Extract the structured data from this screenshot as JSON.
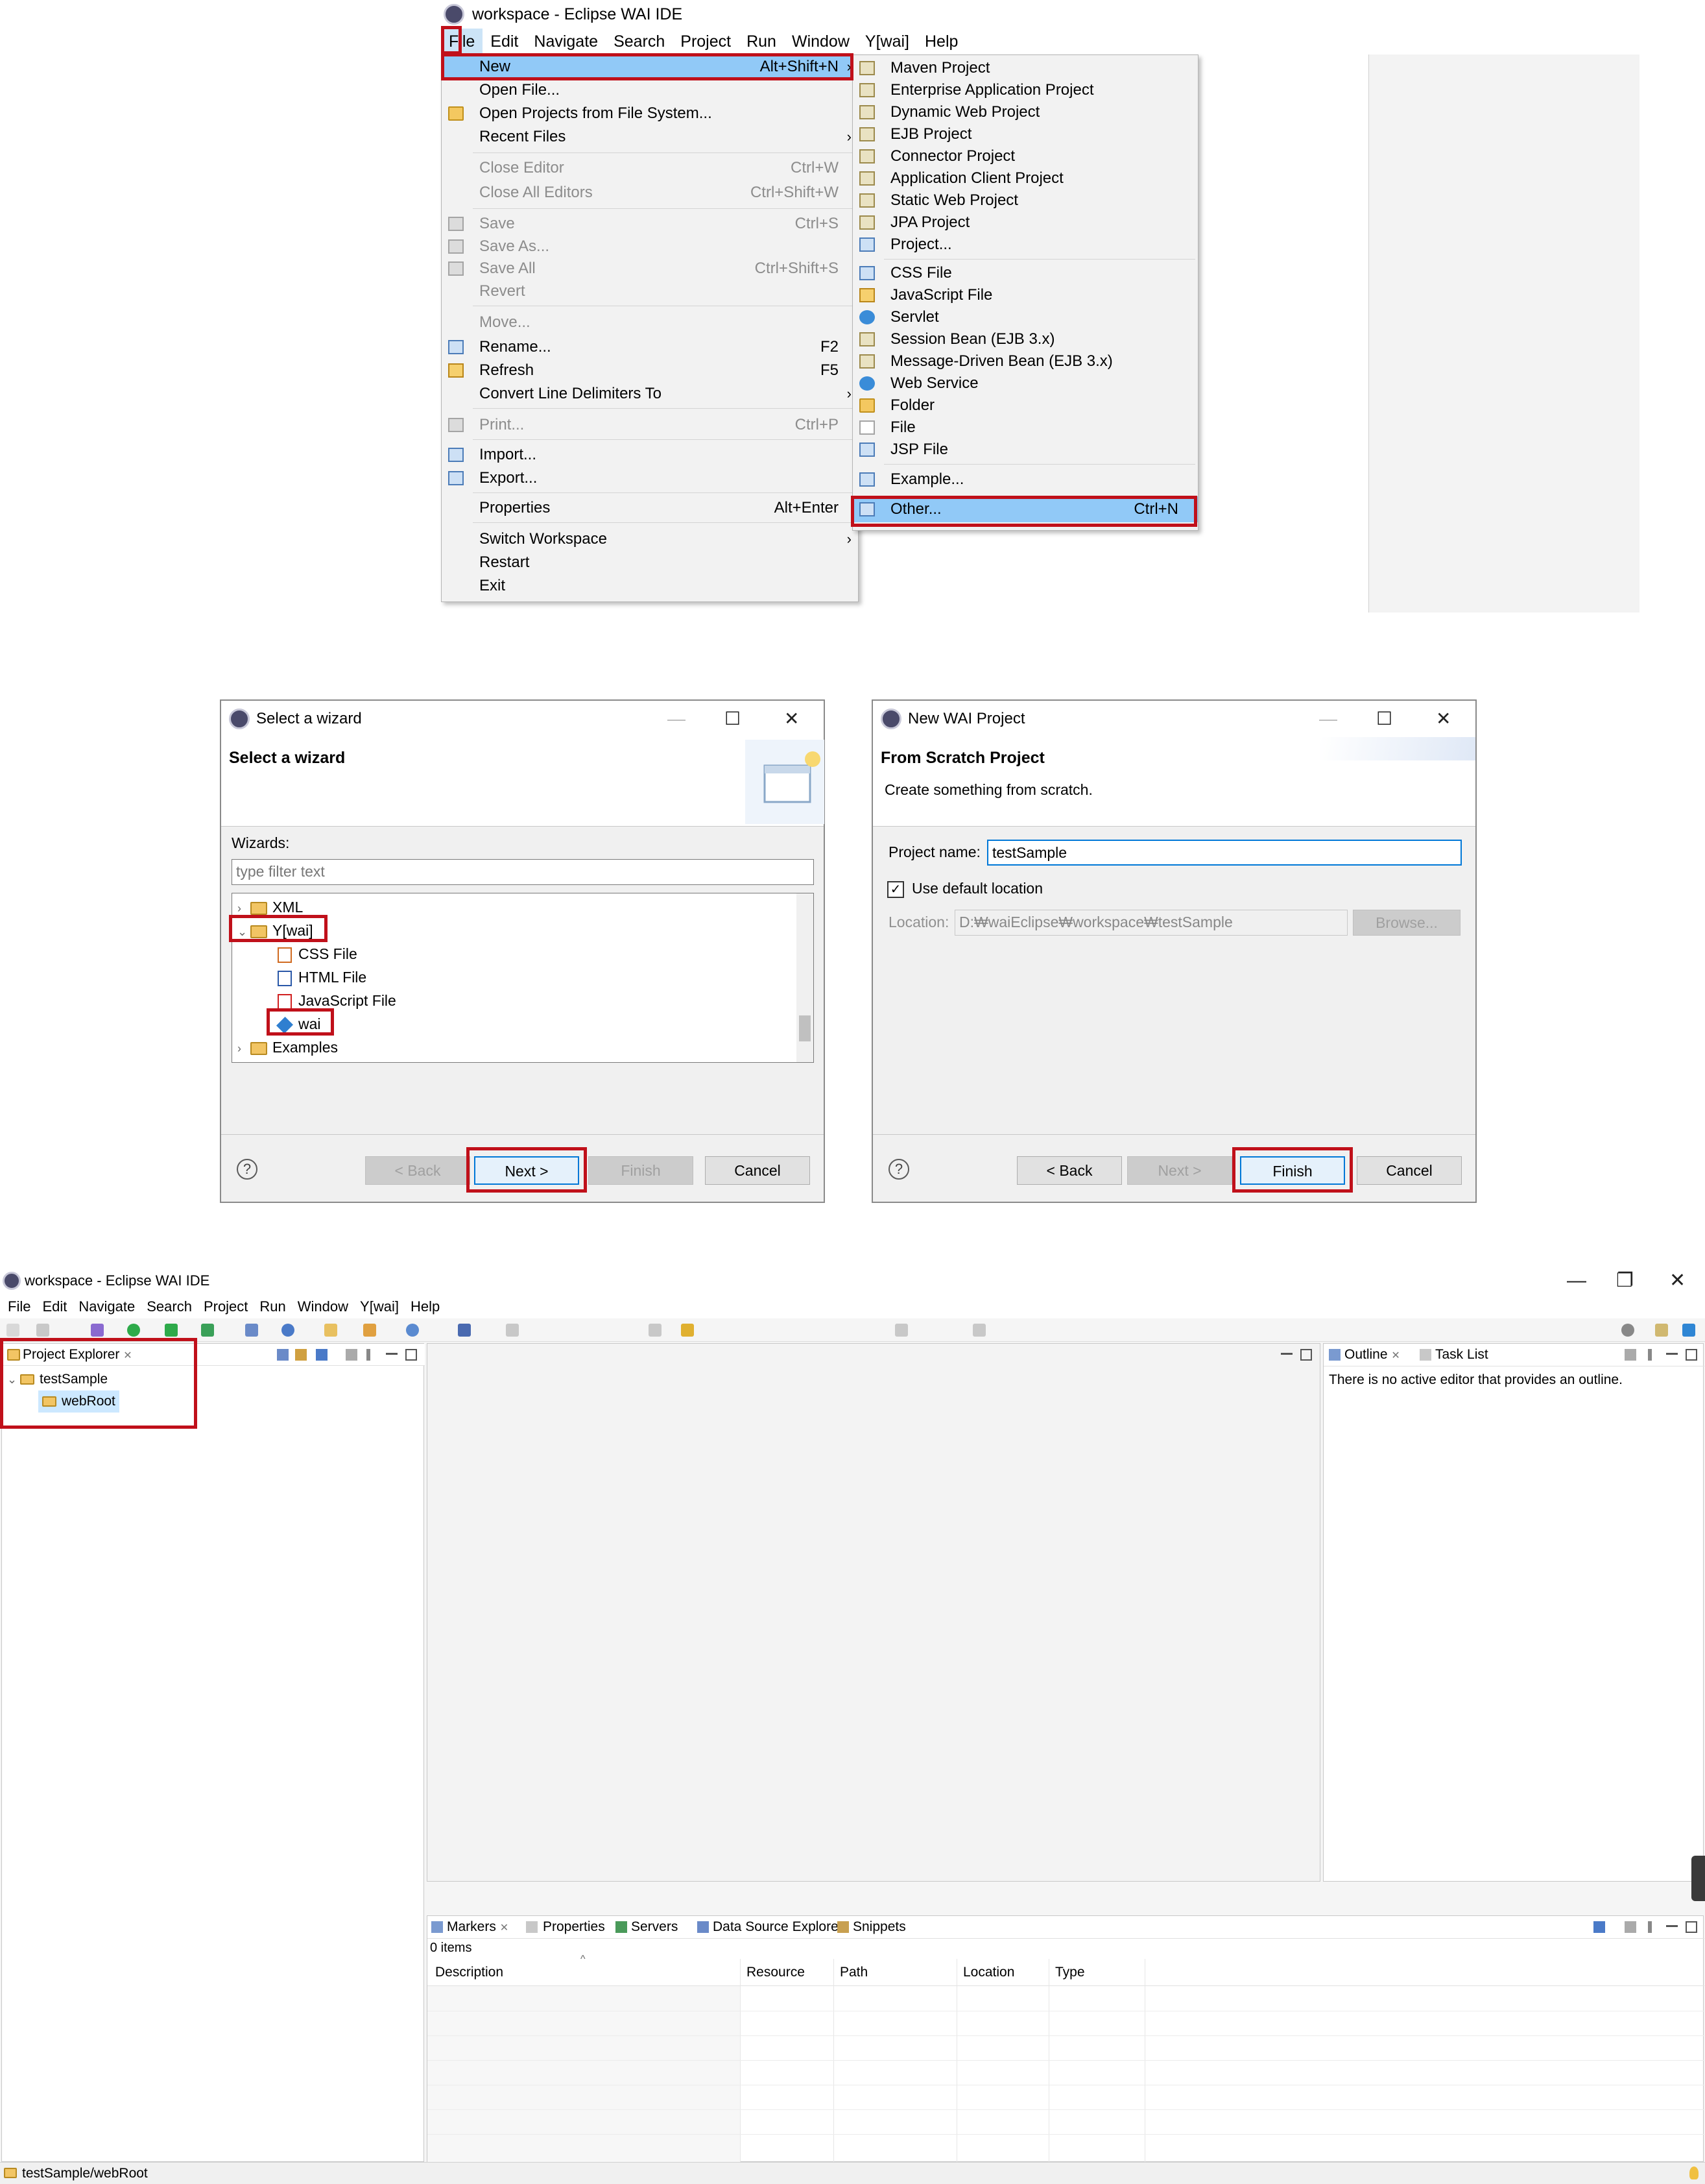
{
  "section1": {
    "window_title": "workspace - Eclipse WAI IDE",
    "menubar": [
      "File",
      "Edit",
      "Navigate",
      "Search",
      "Project",
      "Run",
      "Window",
      "Y[wai]",
      "Help"
    ],
    "file_menu": {
      "new": {
        "label": "New",
        "shortcut": "Alt+Shift+N",
        "arrow": "›"
      },
      "open_file": "Open File...",
      "open_projects": "Open Projects from File System...",
      "recent_files": "Recent Files",
      "close_editor": "Close Editor",
      "close_editor_sc": "Ctrl+W",
      "close_all": "Close All Editors",
      "close_all_sc": "Ctrl+Shift+W",
      "save": "Save",
      "save_sc": "Ctrl+S",
      "save_as": "Save As...",
      "save_all": "Save All",
      "save_all_sc": "Ctrl+Shift+S",
      "revert": "Revert",
      "move": "Move...",
      "rename": "Rename...",
      "rename_sc": "F2",
      "refresh": "Refresh",
      "refresh_sc": "F5",
      "convert": "Convert Line Delimiters To",
      "print": "Print...",
      "print_sc": "Ctrl+P",
      "import": "Import...",
      "export": "Export...",
      "properties": "Properties",
      "properties_sc": "Alt+Enter",
      "switch_ws": "Switch Workspace",
      "restart": "Restart",
      "exit": "Exit",
      "arrow": "›"
    },
    "new_submenu": {
      "maven": "Maven Project",
      "enterprise": "Enterprise Application Project",
      "dynamic_web": "Dynamic Web Project",
      "ejb": "EJB Project",
      "connector": "Connector Project",
      "app_client": "Application Client Project",
      "static_web": "Static Web Project",
      "jpa": "JPA Project",
      "project": "Project...",
      "css": "CSS File",
      "js": "JavaScript File",
      "servlet": "Servlet",
      "session_bean": "Session Bean (EJB 3.x)",
      "mdb": "Message-Driven Bean (EJB 3.x)",
      "web_service": "Web Service",
      "folder": "Folder",
      "file": "File",
      "jsp": "JSP File",
      "example": "Example...",
      "other": "Other...",
      "other_sc": "Ctrl+N"
    }
  },
  "wizard": {
    "title": "Select a wizard",
    "header_title": "Select a wizard",
    "wizards_label": "Wizards:",
    "filter_placeholder": "type filter text",
    "tree": {
      "xml": "XML",
      "ywai": "Y[wai]",
      "css": "CSS File",
      "html": "HTML File",
      "js": "JavaScript File",
      "wai": "wai",
      "examples": "Examples",
      "collapsed": "›",
      "expanded": "⌄"
    },
    "buttons": {
      "back": "< Back",
      "next": "Next >",
      "finish": "Finish",
      "cancel": "Cancel"
    }
  },
  "newproj": {
    "title": "New WAI Project",
    "header_title": "From Scratch Project",
    "header_sub": "Create something from scratch.",
    "name_label": "Project name:",
    "name_value": "testSample",
    "default_loc": "Use default location",
    "location_label": "Location:",
    "location_value": "D:₩waiEclipse₩workspace₩testSample",
    "browse": "Browse...",
    "buttons": {
      "back": "< Back",
      "next": "Next >",
      "finish": "Finish",
      "cancel": "Cancel"
    }
  },
  "dlg_controls": {
    "min": "—",
    "max": "☐",
    "close": "✕",
    "help": "?",
    "check": "✓"
  },
  "ide": {
    "window_title": "workspace - Eclipse WAI IDE",
    "menubar": [
      "File",
      "Edit",
      "Navigate",
      "Search",
      "Project",
      "Run",
      "Window",
      "Y[wai]",
      "Help"
    ],
    "project_explorer": "Project Explorer",
    "project": "testSample",
    "folder": "webRoot",
    "tree_expanded": "⌄",
    "outline": "Outline",
    "task_list": "Task List",
    "outline_msg": "There is no active editor that provides an outline.",
    "bottom_tabs": [
      "Markers",
      "Properties",
      "Servers",
      "Data Source Explorer",
      "Snippets"
    ],
    "items": "0 items",
    "columns": [
      "Description",
      "Resource",
      "Path",
      "Location",
      "Type"
    ],
    "sort_indicator": "^",
    "status": "testSample/webRoot",
    "close_x": "✕",
    "win_min": "—",
    "win_max": "❐",
    "win_close": "✕"
  }
}
